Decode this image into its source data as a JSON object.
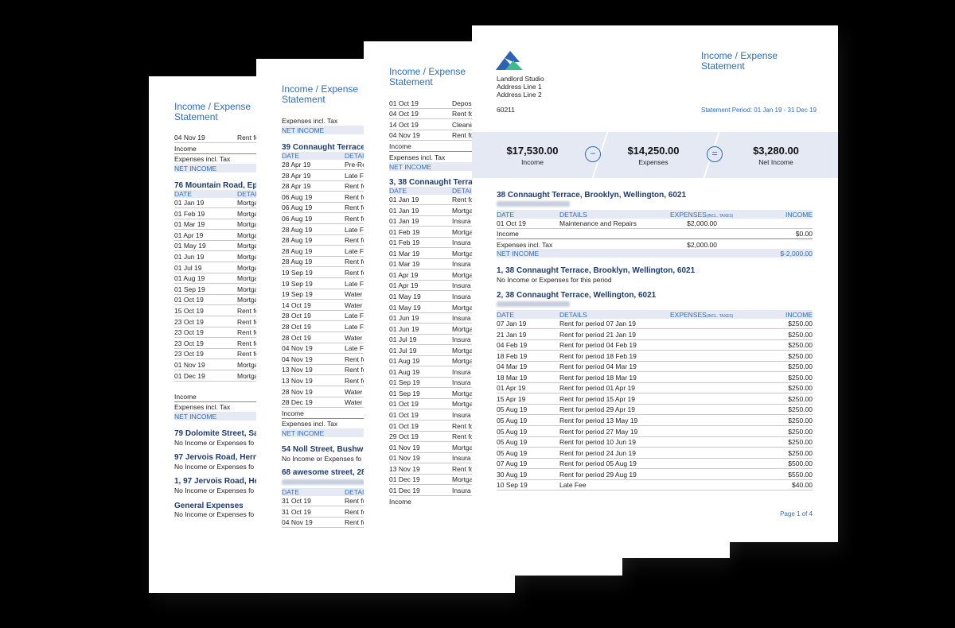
{
  "report_title_line1": "Income / Expense",
  "report_title_line2": "Statement",
  "labels": {
    "income": "Income",
    "expenses": "Expenses",
    "net_income_short": "Net Income",
    "expenses_incl_tax": "Expenses incl. Tax",
    "net_income": "NET INCOME",
    "date": "DATE",
    "details": "DETAILS",
    "expenses_header": "EXPENSES",
    "incl_taxes": "(INCL. TAXES)",
    "income_header": "INCOME",
    "no_activity": "No Income or Expenses for this period"
  },
  "page4": {
    "company": "Landlord Studio",
    "address1": "Address Line 1",
    "address2": "Address Line 2",
    "postcode": "60211",
    "period": "Statement Period: 01 Jan 19 - 31 Dec 19",
    "summary": {
      "income": "$17,530.00",
      "expenses": "$14,250.00",
      "net": "$3,280.00",
      "minus": "−",
      "equals": "="
    },
    "prop1": {
      "name": "38 Connaught Terrace, Brooklyn, Wellington, 6021",
      "rows": [
        {
          "date": "01 Oct 19",
          "details": "Maintenance and Repairs",
          "expense": "$2,000.00",
          "income": ""
        }
      ],
      "income_total": "$0.00",
      "expenses_total": "$2,000.00",
      "net": "$-2,000.00"
    },
    "prop2": {
      "name": "1, 38 Connaught Terrace, Brooklyn, Wellington, 6021"
    },
    "prop3": {
      "name": "2, 38 Connaught Terrace, Wellington, 6021",
      "rows": [
        {
          "date": "07 Jan 19",
          "details": "Rent for period 07 Jan 19",
          "income": "$250.00"
        },
        {
          "date": "21 Jan 19",
          "details": "Rent for period 21 Jan 19",
          "income": "$250.00"
        },
        {
          "date": "04 Feb 19",
          "details": "Rent for period 04 Feb 19",
          "income": "$250.00"
        },
        {
          "date": "18 Feb 19",
          "details": "Rent for period 18 Feb 19",
          "income": "$250.00"
        },
        {
          "date": "04 Mar 19",
          "details": "Rent for period 04 Mar 19",
          "income": "$250.00"
        },
        {
          "date": "18 Mar 19",
          "details": "Rent for period 18 Mar 19",
          "income": "$250.00"
        },
        {
          "date": "01 Apr 19",
          "details": "Rent for period 01 Apr 19",
          "income": "$250.00"
        },
        {
          "date": "15 Apr 19",
          "details": "Rent for period 15 Apr 19",
          "income": "$250.00"
        },
        {
          "date": "05 Aug 19",
          "details": "Rent for period 29 Apr 19",
          "income": "$250.00"
        },
        {
          "date": "05 Aug 19",
          "details": "Rent for period 13 May 19",
          "income": "$250.00"
        },
        {
          "date": "05 Aug 19",
          "details": "Rent for period 27 May 19",
          "income": "$250.00"
        },
        {
          "date": "05 Aug 19",
          "details": "Rent for period 10 Jun 19",
          "income": "$250.00"
        },
        {
          "date": "05 Aug 19",
          "details": "Rent for period 24 Jun 19",
          "income": "$250.00"
        },
        {
          "date": "07 Aug 19",
          "details": "Rent for period 05 Aug 19",
          "income": "$500.00"
        },
        {
          "date": "30 Aug 19",
          "details": "Rent for period 29 Aug 19",
          "income": "$550.00"
        },
        {
          "date": "10 Sep 19",
          "details": "Late Fee",
          "income": "$40.00"
        }
      ]
    },
    "page_number": "Page 1 of 4"
  },
  "page3": {
    "top_rows": [
      {
        "date": "01 Oct 19",
        "details": "Depos"
      },
      {
        "date": "04 Oct 19",
        "details": "Rent fo"
      },
      {
        "date": "14 Oct 19",
        "details": "Cleanin"
      },
      {
        "date": "04 Nov 19",
        "details": "Rent fo"
      }
    ],
    "prop": "3, 38 Connaught Terra",
    "rows": [
      {
        "date": "01 Jan 19",
        "details": "Rent fo"
      },
      {
        "date": "01 Jan 19",
        "details": "Mortga"
      },
      {
        "date": "01 Jan 19",
        "details": "Insura"
      },
      {
        "date": "01 Feb 19",
        "details": "Mortga"
      },
      {
        "date": "01 Feb 19",
        "details": "Insura"
      },
      {
        "date": "01 Mar 19",
        "details": "Mortga"
      },
      {
        "date": "01 Mar 19",
        "details": "Insura"
      },
      {
        "date": "01 Apr 19",
        "details": "Mortga"
      },
      {
        "date": "01 Apr 19",
        "details": "Insura"
      },
      {
        "date": "01 May 19",
        "details": "Insura"
      },
      {
        "date": "01 May 19",
        "details": "Mortga"
      },
      {
        "date": "01 Jun 19",
        "details": "Insura"
      },
      {
        "date": "01 Jun 19",
        "details": "Mortga"
      },
      {
        "date": "01 Jul 19",
        "details": "Insura"
      },
      {
        "date": "01 Jul 19",
        "details": "Mortga"
      },
      {
        "date": "01 Aug 19",
        "details": "Mortga"
      },
      {
        "date": "01 Aug 19",
        "details": "Insura"
      },
      {
        "date": "01 Sep 19",
        "details": "Insura"
      },
      {
        "date": "01 Sep 19",
        "details": "Mortga"
      },
      {
        "date": "01 Oct 19",
        "details": "Mortga"
      },
      {
        "date": "01 Oct 19",
        "details": "Insura"
      },
      {
        "date": "01 Oct 19",
        "details": "Rent fo"
      },
      {
        "date": "29 Oct 19",
        "details": "Rent fo"
      },
      {
        "date": "01 Nov 19",
        "details": "Mortga"
      },
      {
        "date": "01 Nov 19",
        "details": "Insura"
      },
      {
        "date": "13 Nov 19",
        "details": "Rent fo"
      },
      {
        "date": "01 Dec 19",
        "details": "Mortga"
      },
      {
        "date": "01 Dec 19",
        "details": "Insura"
      }
    ]
  },
  "page2": {
    "prop1": "39 Connaught Terrace",
    "rows": [
      {
        "date": "28 Apr 19",
        "details": "Pre-Re"
      },
      {
        "date": "28 Apr 19",
        "details": "Late F"
      },
      {
        "date": "28 Apr 19",
        "details": "Rent fo"
      },
      {
        "date": "06 Aug 19",
        "details": "Rent fo"
      },
      {
        "date": "06 Aug 19",
        "details": "Rent fo"
      },
      {
        "date": "06 Aug 19",
        "details": "Rent fo"
      },
      {
        "date": "28 Aug 19",
        "details": "Late F"
      },
      {
        "date": "28 Aug 19",
        "details": "Rent fo"
      },
      {
        "date": "28 Aug 19",
        "details": "Late F"
      },
      {
        "date": "28 Aug 19",
        "details": "Rent fo"
      },
      {
        "date": "19 Sep 19",
        "details": "Rent fo"
      },
      {
        "date": "19 Sep 19",
        "details": "Late F"
      },
      {
        "date": "19 Sep 19",
        "details": "Water"
      },
      {
        "date": "14 Oct 19",
        "details": "Water"
      },
      {
        "date": "28 Oct 19",
        "details": "Late F"
      },
      {
        "date": "28 Oct 19",
        "details": "Late F"
      },
      {
        "date": "28 Oct 19",
        "details": "Water"
      },
      {
        "date": "04 Nov 19",
        "details": "Late F"
      },
      {
        "date": "04 Nov 19",
        "details": "Rent fo"
      },
      {
        "date": "13 Nov 19",
        "details": "Rent fo"
      },
      {
        "date": "13 Nov 19",
        "details": "Rent fo"
      },
      {
        "date": "28 Nov 19",
        "details": "Water"
      },
      {
        "date": "28 Dec 19",
        "details": "Water"
      }
    ],
    "prop2": "54 Noll Street, Bushwic",
    "prop3": "68 awesome street, 28",
    "rows2": [
      {
        "date": "31 Oct 19",
        "details": "Rent fo"
      },
      {
        "date": "31 Oct 19",
        "details": "Rent fo"
      },
      {
        "date": "04 Nov 19",
        "details": "Rent fo"
      }
    ]
  },
  "page1": {
    "top_row": {
      "date": "04 Nov 19",
      "details": "Rent fo"
    },
    "prop1": "76 Mountain Road, Eps",
    "rows": [
      {
        "date": "01 Jan 19",
        "details": "Mortga"
      },
      {
        "date": "01 Feb 19",
        "details": "Mortga"
      },
      {
        "date": "01 Mar 19",
        "details": "Mortga"
      },
      {
        "date": "01 Apr 19",
        "details": "Mortga"
      },
      {
        "date": "01 May 19",
        "details": "Mortga"
      },
      {
        "date": "01 Jun 19",
        "details": "Mortga"
      },
      {
        "date": "01 Jul 19",
        "details": "Mortga"
      },
      {
        "date": "01 Aug 19",
        "details": "Mortga"
      },
      {
        "date": "01 Sep 19",
        "details": "Mortga"
      },
      {
        "date": "01 Oct 19",
        "details": "Mortga"
      },
      {
        "date": "15 Oct 19",
        "details": "Rent fo"
      },
      {
        "date": "23 Oct 19",
        "details": "Rent fo"
      },
      {
        "date": "23 Oct 19",
        "details": "Rent fo"
      },
      {
        "date": "23 Oct 19",
        "details": "Rent fo"
      },
      {
        "date": "23 Oct 19",
        "details": "Rent fo"
      },
      {
        "date": "01 Nov 19",
        "details": "Mortga"
      },
      {
        "date": "01 Dec 19",
        "details": "Mortga"
      }
    ],
    "prop2": "79 Dolomite Street, Sa",
    "prop3": "97 Jervois Road, Herne",
    "prop4": "1, 97 Jervois Road, He",
    "prop5": "General Expenses",
    "no_activity_cut": "No Income or Expenses fo"
  }
}
